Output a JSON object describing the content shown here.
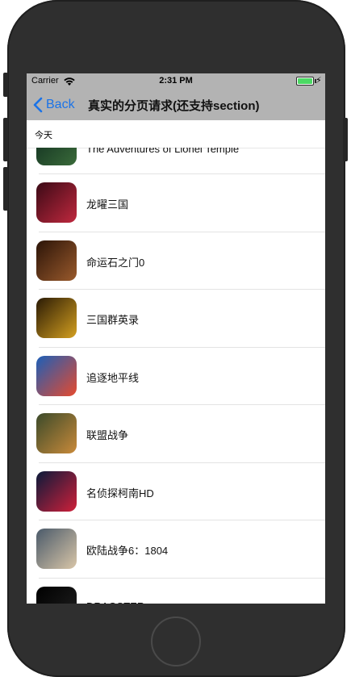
{
  "status_bar": {
    "carrier": "Carrier",
    "time": "2:31 PM",
    "battery_color": "#4cd964"
  },
  "nav": {
    "back_label": "Back",
    "title": "真实的分页请求(还支持section)"
  },
  "section": {
    "header": "今天"
  },
  "rows": [
    {
      "label": "The Adventures of Lionel Temple",
      "icon": "game-icon",
      "colors": [
        "#0e2a1e",
        "#3a6b3a"
      ]
    },
    {
      "label": "龙曜三国",
      "icon": "game-icon",
      "colors": [
        "#3b0a16",
        "#c0283e"
      ]
    },
    {
      "label": "命运石之门0",
      "icon": "game-icon",
      "colors": [
        "#2b1408",
        "#9a5a2c"
      ]
    },
    {
      "label": "三国群英录",
      "icon": "game-icon",
      "colors": [
        "#2a1a05",
        "#d4a020"
      ]
    },
    {
      "label": "追逐地平线",
      "icon": "game-icon",
      "colors": [
        "#1c5fb8",
        "#e64a2e"
      ]
    },
    {
      "label": "联盟战争",
      "icon": "game-icon",
      "colors": [
        "#3b4a2a",
        "#c98a3a"
      ]
    },
    {
      "label": "名侦探柯南HD",
      "icon": "game-icon",
      "colors": [
        "#0a1a3a",
        "#d0203a"
      ]
    },
    {
      "label": "欧陆战争6：1804",
      "icon": "game-icon",
      "colors": [
        "#4a5a6a",
        "#d9c6a8"
      ]
    },
    {
      "label": "DRAGSTER",
      "icon": "game-icon",
      "colors": [
        "#000000",
        "#222222"
      ]
    }
  ]
}
